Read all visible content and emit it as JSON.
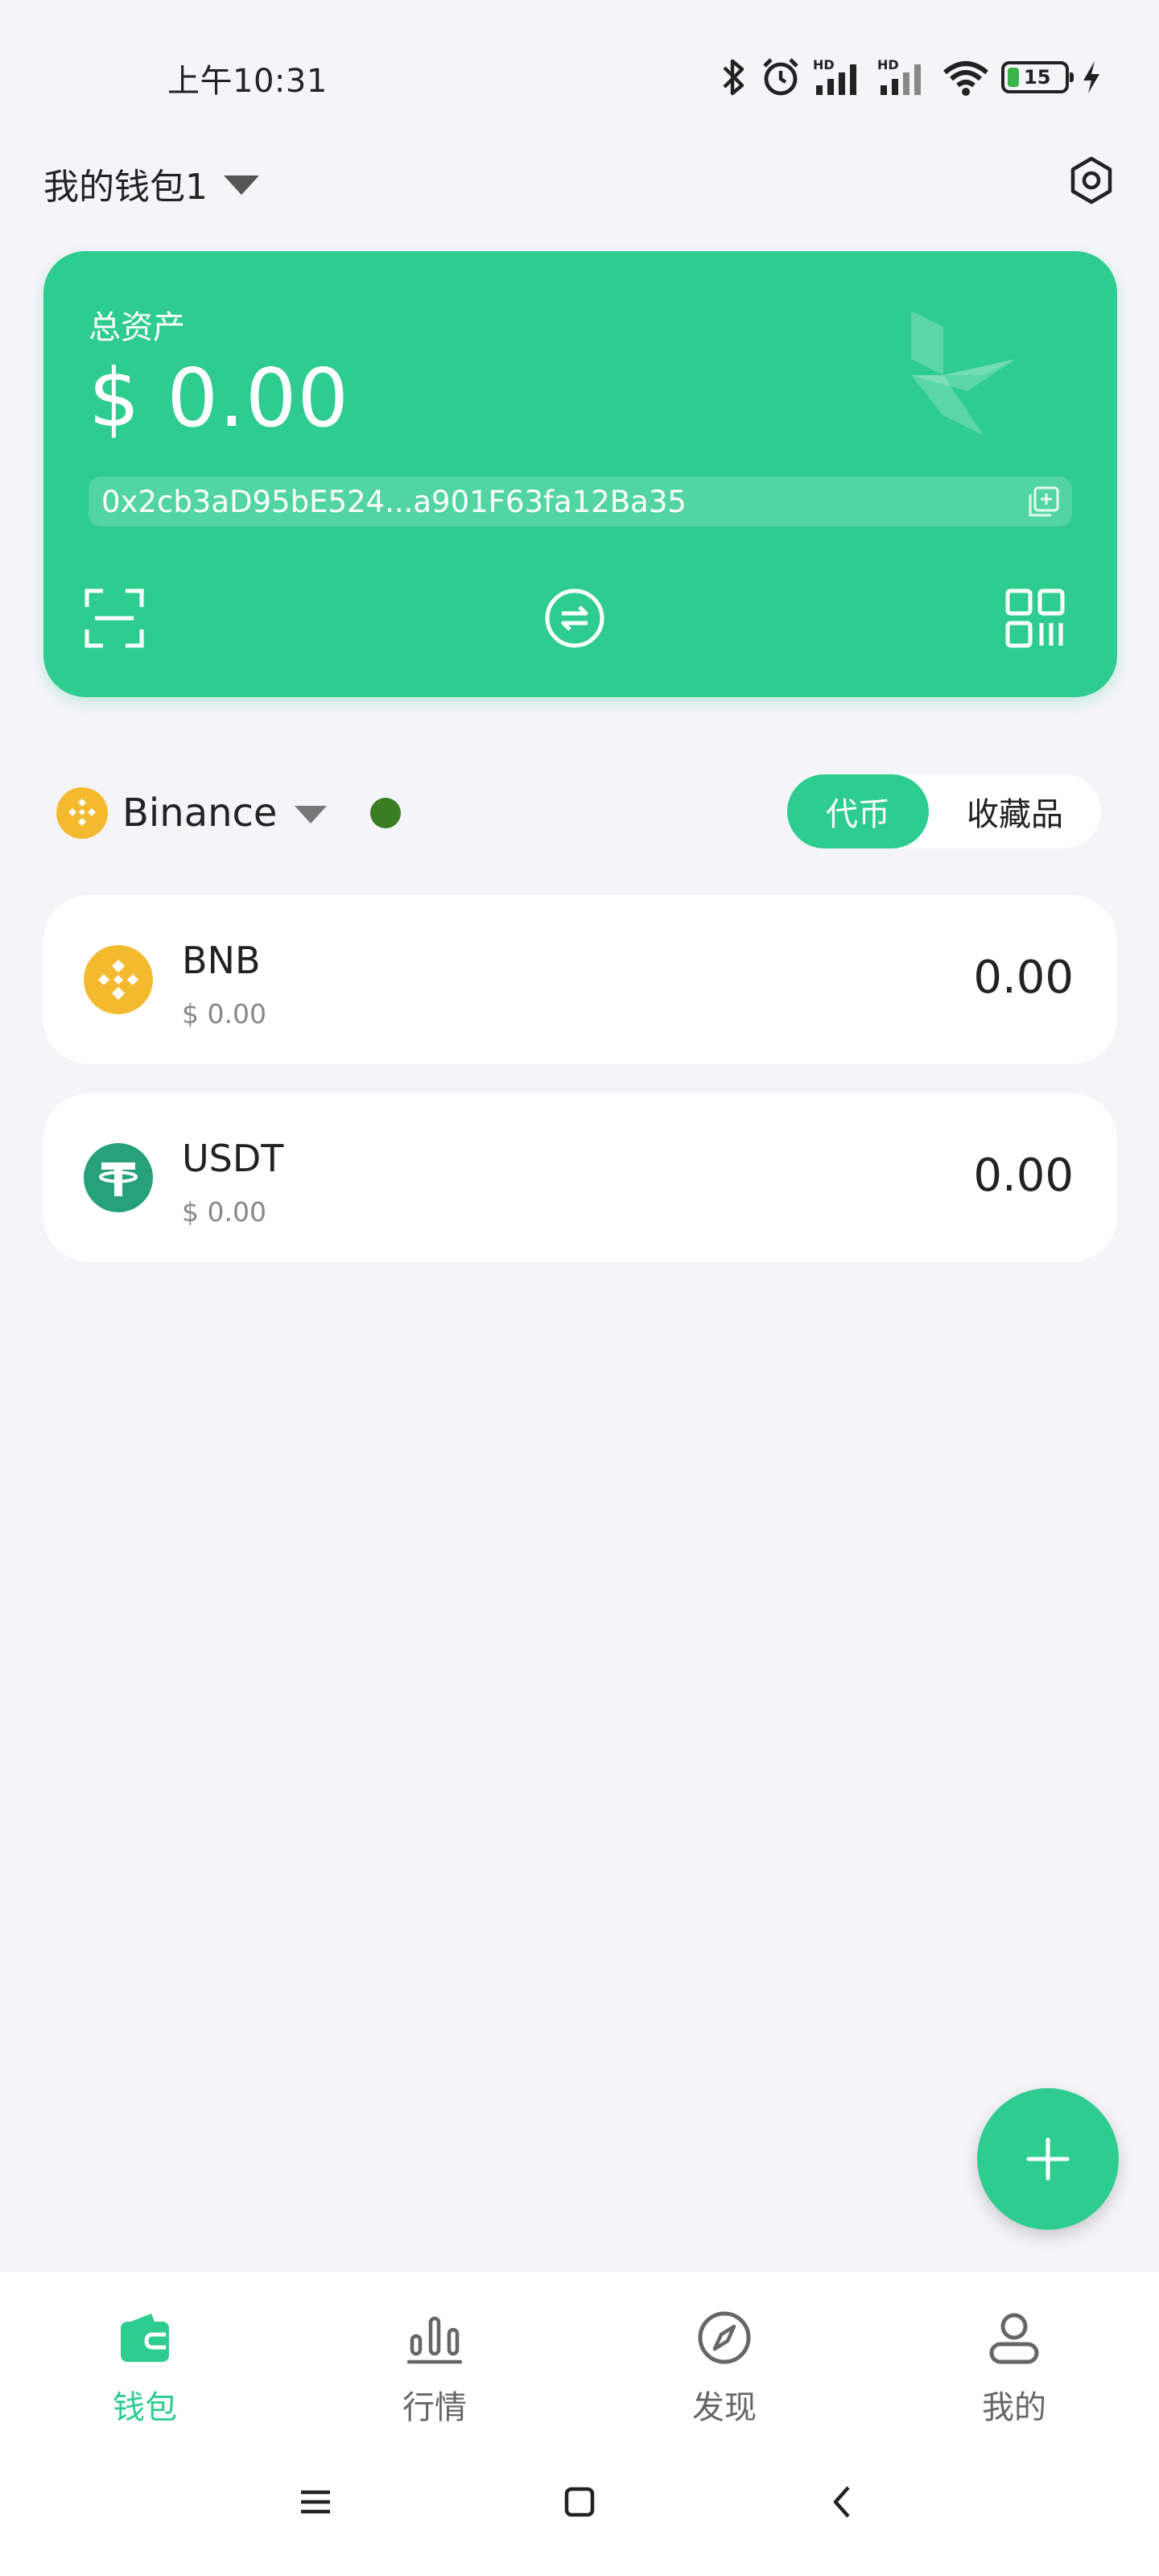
{
  "status_bar": {
    "time": "上午10:31",
    "battery_level": "15",
    "icons": [
      "bluetooth-icon",
      "alarm-icon",
      "signal-hd-1-icon",
      "signal-hd-2-icon",
      "wifi-icon",
      "battery-icon",
      "charging-icon"
    ]
  },
  "header": {
    "wallet_name": "我的钱包1",
    "settings_icon": "hexagon-settings-icon"
  },
  "asset_card": {
    "label": "总资产",
    "amount": "$ 0.00",
    "address": "0x2cb3aD95bE524...a901F63fa12Ba35",
    "background_color": "#2ecc8e",
    "actions": [
      "scan-icon",
      "transfer-icon",
      "qr-code-icon"
    ]
  },
  "network": {
    "name": "Binance",
    "status_color": "#3a7d22"
  },
  "tabs": {
    "tokens": "代币",
    "collectibles": "收藏品"
  },
  "tokens": [
    {
      "symbol": "BNB",
      "fiat": "$ 0.00",
      "balance": "0.00",
      "icon": "bnb-icon",
      "color": "#f3ba2f"
    },
    {
      "symbol": "USDT",
      "fiat": "$ 0.00",
      "balance": "0.00",
      "icon": "tether-icon",
      "color": "#26a17b"
    }
  ],
  "bottom_nav": {
    "items": [
      {
        "label": "钱包",
        "icon": "wallet-icon",
        "active": true
      },
      {
        "label": "行情",
        "icon": "market-chart-icon",
        "active": false
      },
      {
        "label": "发现",
        "icon": "compass-icon",
        "active": false
      },
      {
        "label": "我的",
        "icon": "profile-icon",
        "active": false
      }
    ]
  },
  "system_nav": [
    "menu-icon",
    "home-icon",
    "back-icon"
  ]
}
